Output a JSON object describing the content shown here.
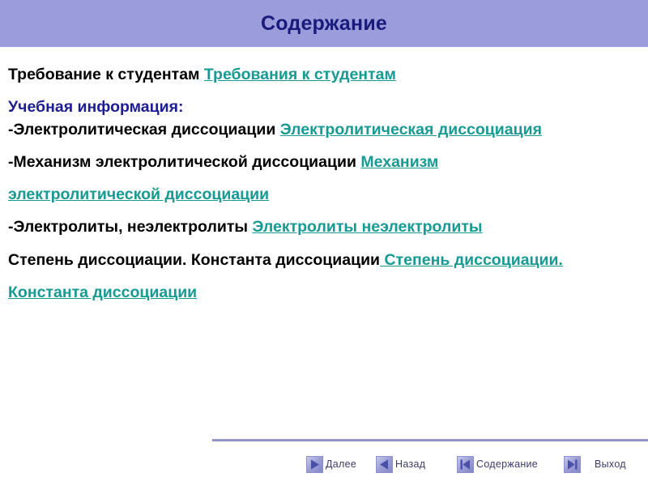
{
  "header": {
    "title": "Содержание",
    "bg_color": "#9a9cdc",
    "title_color": "#1a1a7a"
  },
  "colors": {
    "link": "#179a93",
    "heading_blue": "#1d1d96",
    "body_text": "#000000",
    "rule": "#9294c8",
    "nav_label": "#3b3b6b"
  },
  "content": {
    "line1": {
      "text": "Требование к студентам ",
      "link": "Требования к студентам"
    },
    "line2": {
      "heading": "Учебная информация:"
    },
    "line3": {
      "text": "-Электролитическая диссоциации ",
      "link": "Электролитическая диссоциация"
    },
    "line4": {
      "text": "-Механизм электролитической диссоциации ",
      "link": "Механизм"
    },
    "line5": {
      "link": "электролитической диссоциации"
    },
    "line6": {
      "text": "-Электролиты, неэлектролиты ",
      "link": "Электролиты неэлектролиты"
    },
    "line7": {
      "text": "Степень диссоциации. Константа диссоциации",
      "link": " Степень диссоциации."
    },
    "line8": {
      "link": "Константа диссоциации"
    }
  },
  "footer": {
    "nav": [
      {
        "label": "Далее",
        "icon": "play-right-icon"
      },
      {
        "label": "Назад",
        "icon": "play-left-icon"
      },
      {
        "label": "Содержание",
        "icon": "skip-to-start-icon"
      },
      {
        "label": "Выход",
        "icon": "skip-to-end-icon"
      }
    ]
  }
}
